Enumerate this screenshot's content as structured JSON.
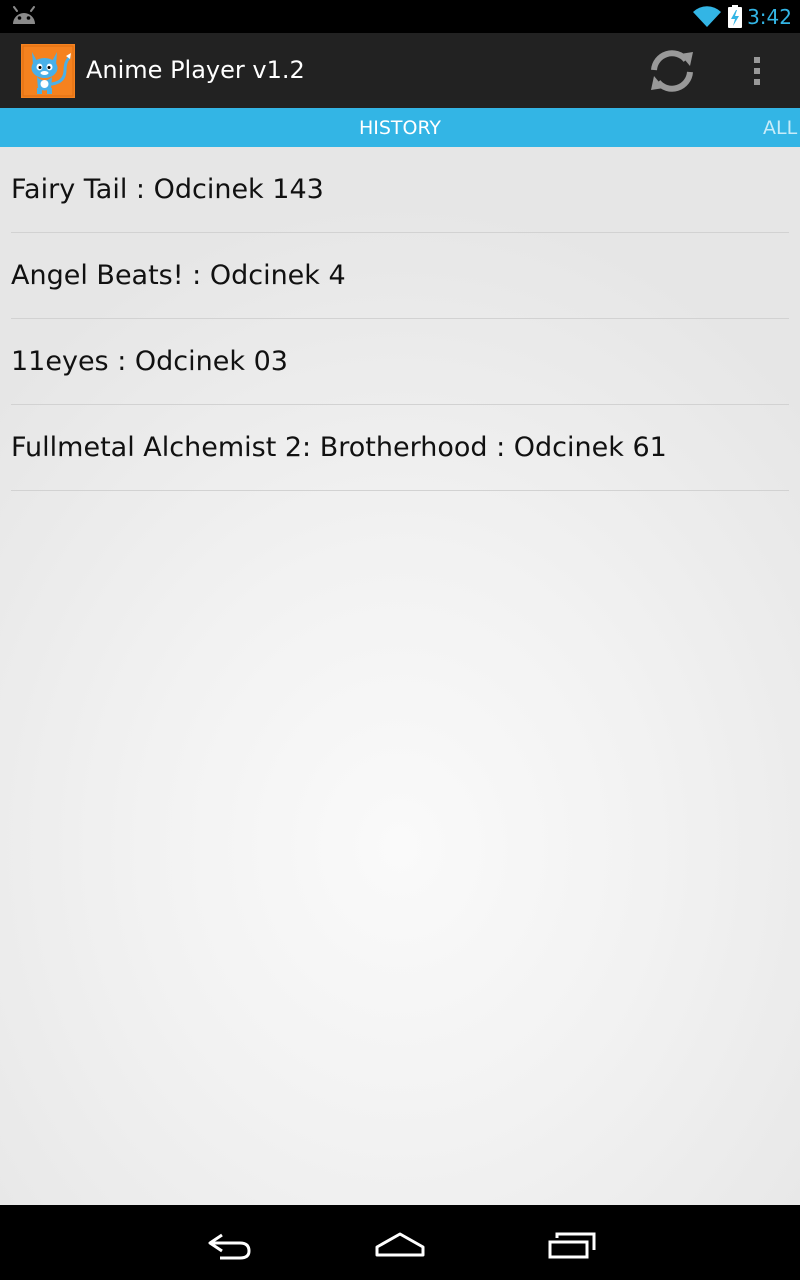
{
  "status_bar": {
    "time": "3:42",
    "icons": [
      "android-debug-icon",
      "wifi-icon",
      "battery-charging-icon"
    ]
  },
  "action_bar": {
    "title": "Anime Player v1.2",
    "icons": [
      "app-logo-icon",
      "refresh-icon",
      "overflow-menu-icon"
    ]
  },
  "tabs": [
    {
      "label": "HISTORY",
      "selected": true
    },
    {
      "label": "ALL",
      "selected": false
    }
  ],
  "history": [
    {
      "title": "Fairy Tail : Odcinek 143"
    },
    {
      "title": "Angel Beats! : Odcinek 4"
    },
    {
      "title": "11eyes : Odcinek 03"
    },
    {
      "title": "Fullmetal Alchemist 2: Brotherhood : Odcinek 61"
    }
  ],
  "nav_bar": {
    "icons": [
      "back-icon",
      "home-icon",
      "recents-icon"
    ]
  },
  "colors": {
    "accent": "#33b5e5",
    "action_bar": "#222222",
    "status_bar": "#000000",
    "app_icon_bg": "#f5821f"
  }
}
